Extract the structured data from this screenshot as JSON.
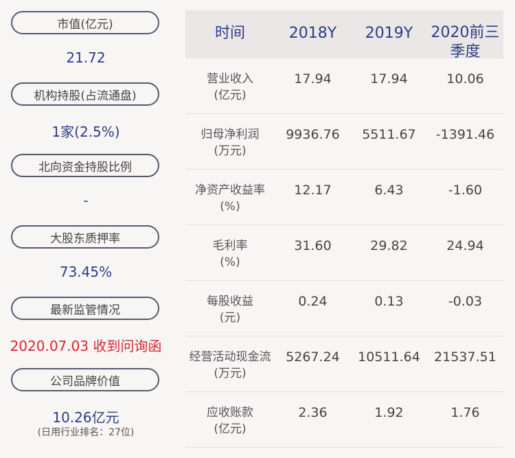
{
  "left_panel": {
    "items": [
      {
        "label": "市值(亿元)",
        "value": "21.72"
      },
      {
        "label": "机构持股(占流通盘)",
        "value": "1家(2.5%)"
      },
      {
        "label": "北向资金持股比例",
        "value": "-"
      },
      {
        "label": "大股东质押率",
        "value": "73.45%"
      },
      {
        "label": "最新监管情况",
        "value": "2020.07.03 收到问询函"
      },
      {
        "label": "公司品牌价值",
        "value": "10.26亿元",
        "note": "(日用行业排名：27位)"
      }
    ],
    "colors": {
      "value": "#2c3d86",
      "alert": "#d6282f",
      "pill_border": "#555a6b"
    }
  },
  "table": {
    "headers": [
      "时间",
      "2018Y",
      "2019Y",
      "2020前三季度"
    ],
    "rows": [
      {
        "label": "营业收入",
        "unit": "(亿元)",
        "values": [
          "17.94",
          "17.94",
          "10.06"
        ]
      },
      {
        "label": "归母净利润",
        "unit": "(万元)",
        "values": [
          "9936.76",
          "5511.67",
          "-1391.46"
        ]
      },
      {
        "label": "净资产收益率",
        "unit": "(%)",
        "values": [
          "12.17",
          "6.43",
          "-1.60"
        ]
      },
      {
        "label": "毛利率",
        "unit": "(%)",
        "values": [
          "31.60",
          "29.82",
          "24.94"
        ]
      },
      {
        "label": "每股收益",
        "unit": "(元)",
        "values": [
          "0.24",
          "0.13",
          "-0.03"
        ]
      },
      {
        "label": "经营活动现金流",
        "unit": "(万元)",
        "values": [
          "5267.24",
          "10511.64",
          "21537.51"
        ]
      },
      {
        "label": "应收账款",
        "unit": "(亿元)",
        "values": [
          "2.36",
          "1.92",
          "1.76"
        ]
      }
    ],
    "colors": {
      "header_bg": "#ebe7e7",
      "header_text": "#2c3d86"
    }
  }
}
